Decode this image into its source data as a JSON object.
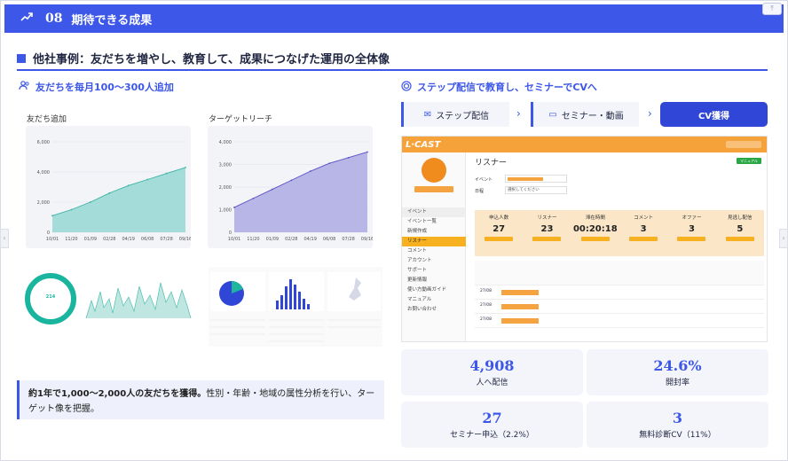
{
  "header": {
    "icon": "trend-up-icon",
    "number": "08",
    "title": "期待できる成果",
    "corner_label": "⤒"
  },
  "section": {
    "title": "他社事例：友だちを増やし、教育して、成果につなげた運用の全体像"
  },
  "left": {
    "heading": "友だちを毎月100〜300人追加",
    "chart1": {
      "title": "友だち追加"
    },
    "chart2": {
      "title": "ターゲットリーチ"
    },
    "summary_bold": "約1年で1,000〜2,000人の友だちを獲得。",
    "summary_rest": "性別・年齢・地域の属性分析を行い、ターゲット像を把握。",
    "donut_value": "214"
  },
  "chart_data": [
    {
      "type": "area",
      "title": "友だち追加",
      "x": [
        "10/01",
        "11/20",
        "01/09",
        "02/28",
        "04/19",
        "06/08",
        "07/28",
        "09/16"
      ],
      "values": [
        1100,
        1500,
        2000,
        2600,
        3100,
        3500,
        3900,
        4300
      ],
      "ylim": [
        0,
        6000
      ],
      "yticks": [
        "0",
        "2,000",
        "4,000",
        "6,000"
      ],
      "color": "#8fd6cf",
      "line_color": "#3bb3a6"
    },
    {
      "type": "area",
      "title": "ターゲットリーチ",
      "x": [
        "10/01",
        "11/20",
        "01/09",
        "02/28",
        "04/19",
        "06/08",
        "07/28",
        "09/16"
      ],
      "values": [
        1100,
        1500,
        1900,
        2300,
        2700,
        3050,
        3300,
        3550
      ],
      "ylim": [
        0,
        4000
      ],
      "yticks": [
        "0",
        "1,000",
        "2,000",
        "3,000",
        "4,000"
      ],
      "color": "#a9a5e2",
      "line_color": "#5a51c6"
    }
  ],
  "right": {
    "heading": "ステップ配信で教育し、セミナーでCVへ",
    "tabs": [
      {
        "label": "ステップ配信",
        "icon": "mail-icon"
      },
      {
        "label": "セミナー・動画",
        "icon": "video-icon"
      },
      {
        "label": "CV獲得"
      }
    ],
    "app": {
      "logo": "L·CAST",
      "page_title": "リスナー",
      "badge": "マニュアル",
      "field_event": "イベント",
      "field_date": "日程",
      "date_placeholder": "選択してください",
      "menu": [
        "イベント",
        "イベント一覧",
        "新規作成",
        "リスナー",
        "コメント",
        "アカウント",
        "サポート",
        "更新情報",
        "使い方動画ガイド",
        "マニュアル",
        "お問い合わせ"
      ],
      "kpis": [
        {
          "label": "申込人数",
          "value": "27"
        },
        {
          "label": "リスナー",
          "value": "23"
        },
        {
          "label": "滞在時間",
          "value": "00:20:18"
        },
        {
          "label": "コメント",
          "value": "3"
        },
        {
          "label": "オファー",
          "value": "3"
        },
        {
          "label": "見逃し配信",
          "value": "5"
        }
      ],
      "rows": [
        "27/08",
        "27/08",
        "27/08"
      ]
    },
    "metrics": [
      {
        "value": "4,908",
        "label": "人へ配信"
      },
      {
        "value": "24.6%",
        "label": "開封率"
      },
      {
        "value": "27",
        "label": "セミナー申込（2.2%）"
      },
      {
        "value": "3",
        "label": "無料診断CV（11%）"
      }
    ]
  }
}
